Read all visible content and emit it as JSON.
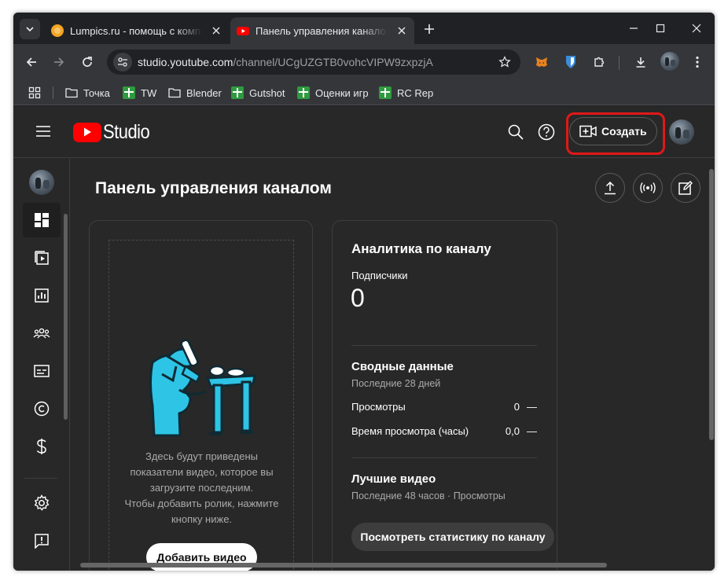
{
  "browser": {
    "tabs": [
      {
        "title": "Lumpics.ru - помощь с компьютером",
        "favicon": "orange-circle-icon",
        "active": false
      },
      {
        "title": "Панель управления каналом - YouTube Studio",
        "favicon": "youtube-icon",
        "active": true
      }
    ],
    "url": {
      "domain": "studio.youtube.com",
      "path": "/channel/UCgUZGTB0vohcVIPW9zxpzjA"
    },
    "bookmarks": [
      {
        "label": "Точка",
        "icon": "folder-icon"
      },
      {
        "label": "TW",
        "icon": "green-cross-icon"
      },
      {
        "label": "Blender",
        "icon": "folder-icon"
      },
      {
        "label": "Gutshot",
        "icon": "green-cross-icon"
      },
      {
        "label": "Оценки игр",
        "icon": "green-cross-icon"
      },
      {
        "label": "RC Rep",
        "icon": "green-cross-icon"
      }
    ]
  },
  "studio": {
    "logo_text": "Studio",
    "create_label": "Создать",
    "page_title": "Панель управления каналом"
  },
  "upload_card": {
    "text_line1": "Здесь будут приведены",
    "text_line2": "показатели видео, которое вы",
    "text_line3": "загрузите последним.",
    "text_line4": "Чтобы добавить ролик, нажмите",
    "text_line5": "кнопку ниже.",
    "button_label": "Добавить видео"
  },
  "analytics_card": {
    "title": "Аналитика по каналу",
    "subscribers_label": "Подписчики",
    "subscribers_count": "0",
    "summary_title": "Сводные данные",
    "summary_period": "Последние 28 дней",
    "rows": [
      {
        "label": "Просмотры",
        "value": "0",
        "delta": "—"
      },
      {
        "label": "Время просмотра (часы)",
        "value": "0,0",
        "delta": "—"
      }
    ],
    "top_videos_title": "Лучшие видео",
    "top_videos_period": "Последние 48 часов · Просмотры",
    "stats_button": "Посмотреть статистику по каналу"
  },
  "colors": {
    "brand_red": "#ff0000",
    "highlight": "#e01818",
    "page_bg": "#282828",
    "illustration": "#2ec4e6"
  }
}
